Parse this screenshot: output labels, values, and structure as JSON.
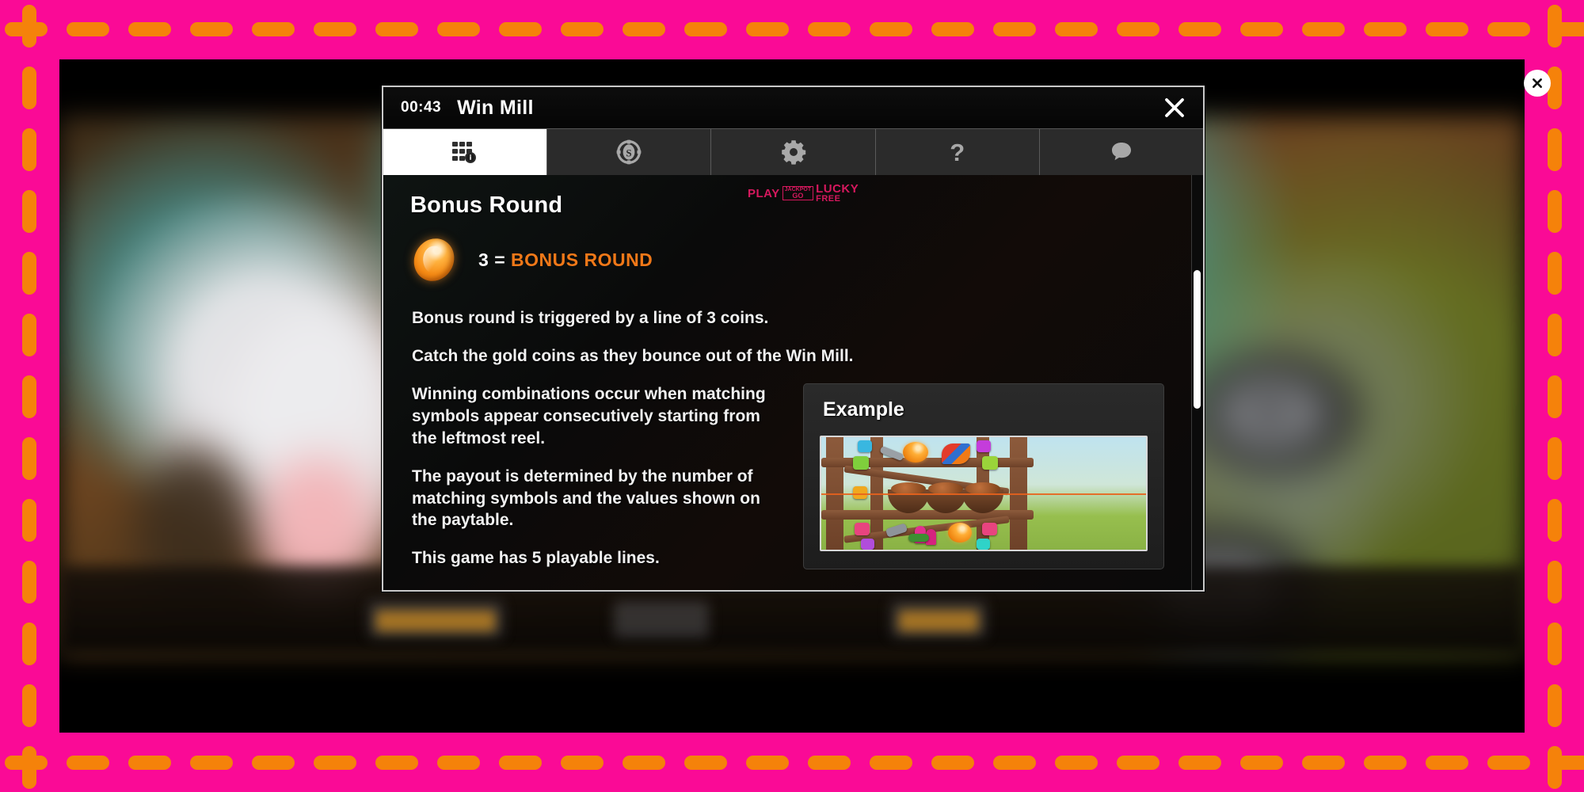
{
  "frame": {
    "background_color": "#fa0a96",
    "dash_color": "#f5820a"
  },
  "game": {
    "close_round_icon": "close-icon",
    "bottom_bar_present": true
  },
  "dialog": {
    "clock": "00:43",
    "title": "Win Mill",
    "close_label": "close-icon",
    "tabs": [
      {
        "id": "paytable",
        "icon": "paytable-info-icon",
        "active": true
      },
      {
        "id": "bets",
        "icon": "casino-chip-icon",
        "active": false
      },
      {
        "id": "settings",
        "icon": "gear-icon",
        "active": false
      },
      {
        "id": "help",
        "icon": "question-mark-icon",
        "label": "?",
        "active": false
      },
      {
        "id": "chat",
        "icon": "chat-bubble-icon",
        "active": false
      }
    ],
    "content": {
      "section_title": "Bonus Round",
      "bonus_symbol": "gold-coin",
      "bonus_count": "3",
      "bonus_equals": "=",
      "bonus_award": "BONUS ROUND",
      "accent_color": "#f07818",
      "paragraphs": [
        "Bonus round is triggered by a line of 3 coins.",
        "Catch the gold coins as they bounce out of the Win Mill.",
        "Winning combinations occur when matching symbols appear consecutively starting from the leftmost reel.",
        "The payout is determined by the number of matching symbols and the values shown on the paytable.",
        "This game has 5 playable lines."
      ],
      "example": {
        "title": "Example",
        "image_alt": "slot-reels-with-winning-line"
      }
    },
    "scrollbar": {
      "thumb_color": "#ffffff"
    }
  },
  "watermark": {
    "play": "PLAY",
    "badge_top": "JACKPOT",
    "badge_bottom": "GO",
    "lucky": "LUCKY",
    "free": "FREE",
    "color": "#d6185e"
  }
}
